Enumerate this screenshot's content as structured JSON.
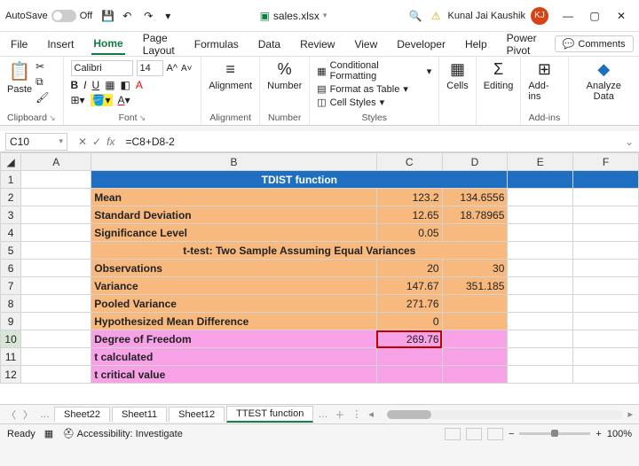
{
  "titlebar": {
    "autosave_label": "AutoSave",
    "autosave_state": "Off",
    "filename": "sales.xlsx",
    "user_name": "Kunal Jai Kaushik",
    "user_initials": "KJ"
  },
  "menu": {
    "tabs": [
      "File",
      "Insert",
      "Home",
      "Page Layout",
      "Formulas",
      "Data",
      "Review",
      "View",
      "Developer",
      "Help",
      "Power Pivot"
    ],
    "active": "Home",
    "comments": "Comments"
  },
  "ribbon": {
    "clipboard": {
      "paste": "Paste",
      "label": "Clipboard"
    },
    "font": {
      "name": "Calibri",
      "size": "14",
      "label": "Font"
    },
    "alignment": {
      "btn": "Alignment",
      "label": "Alignment"
    },
    "number": {
      "btn": "Number",
      "label": "Number"
    },
    "styles": {
      "cond": "Conditional Formatting",
      "table": "Format as Table",
      "cell": "Cell Styles",
      "label": "Styles"
    },
    "cells": {
      "btn": "Cells"
    },
    "editing": {
      "btn": "Editing"
    },
    "addins": {
      "btn": "Add-ins",
      "label": "Add-ins"
    },
    "analyze": {
      "btn": "Analyze Data"
    }
  },
  "formula_bar": {
    "cell_ref": "C10",
    "formula": "=C8+D8-2"
  },
  "grid": {
    "columns": [
      "A",
      "B",
      "C",
      "D",
      "E",
      "F"
    ],
    "r1_title": "TDIST function",
    "r2": {
      "b": "Mean",
      "c": "123.2",
      "d": "134.6556"
    },
    "r3": {
      "b": "Standard Deviation",
      "c": "12.65",
      "d": "18.78965"
    },
    "r4": {
      "b": "Significance Level",
      "c": "0.05",
      "d": ""
    },
    "r5_sub": "t-test: Two Sample Assuming Equal Variances",
    "r6": {
      "b": "Observations",
      "c": "20",
      "d": "30"
    },
    "r7": {
      "b": "Variance",
      "c": "147.67",
      "d": "351.185"
    },
    "r8": {
      "b": "Pooled Variance",
      "c": "271.76",
      "d": ""
    },
    "r9": {
      "b": "Hypothesized Mean Difference",
      "c": "0",
      "d": ""
    },
    "r10": {
      "b": "Degree of Freedom",
      "c": "269.76",
      "d": ""
    },
    "r11": {
      "b": "t calculated"
    },
    "r12": {
      "b": "t critical value"
    }
  },
  "sheets": {
    "tabs": [
      "Sheet22",
      "Sheet11",
      "Sheet12",
      "TTEST function"
    ],
    "active": "TTEST function"
  },
  "status": {
    "ready": "Ready",
    "access": "Accessibility: Investigate",
    "zoom": "100%"
  },
  "chart_data": {
    "type": "table",
    "title": "TDIST function",
    "sections": [
      {
        "rows": [
          {
            "label": "Mean",
            "c": 123.2,
            "d": 134.6556
          },
          {
            "label": "Standard Deviation",
            "c": 12.65,
            "d": 18.78965
          },
          {
            "label": "Significance Level",
            "c": 0.05
          }
        ]
      },
      {
        "title": "t-test: Two Sample Assuming Equal Variances",
        "rows": [
          {
            "label": "Observations",
            "c": 20,
            "d": 30
          },
          {
            "label": "Variance",
            "c": 147.67,
            "d": 351.185
          },
          {
            "label": "Pooled Variance",
            "c": 271.76
          },
          {
            "label": "Hypothesized Mean Difference",
            "c": 0
          },
          {
            "label": "Degree of Freedom",
            "c": 269.76
          },
          {
            "label": "t calculated"
          },
          {
            "label": "t critical value"
          }
        ]
      }
    ]
  }
}
